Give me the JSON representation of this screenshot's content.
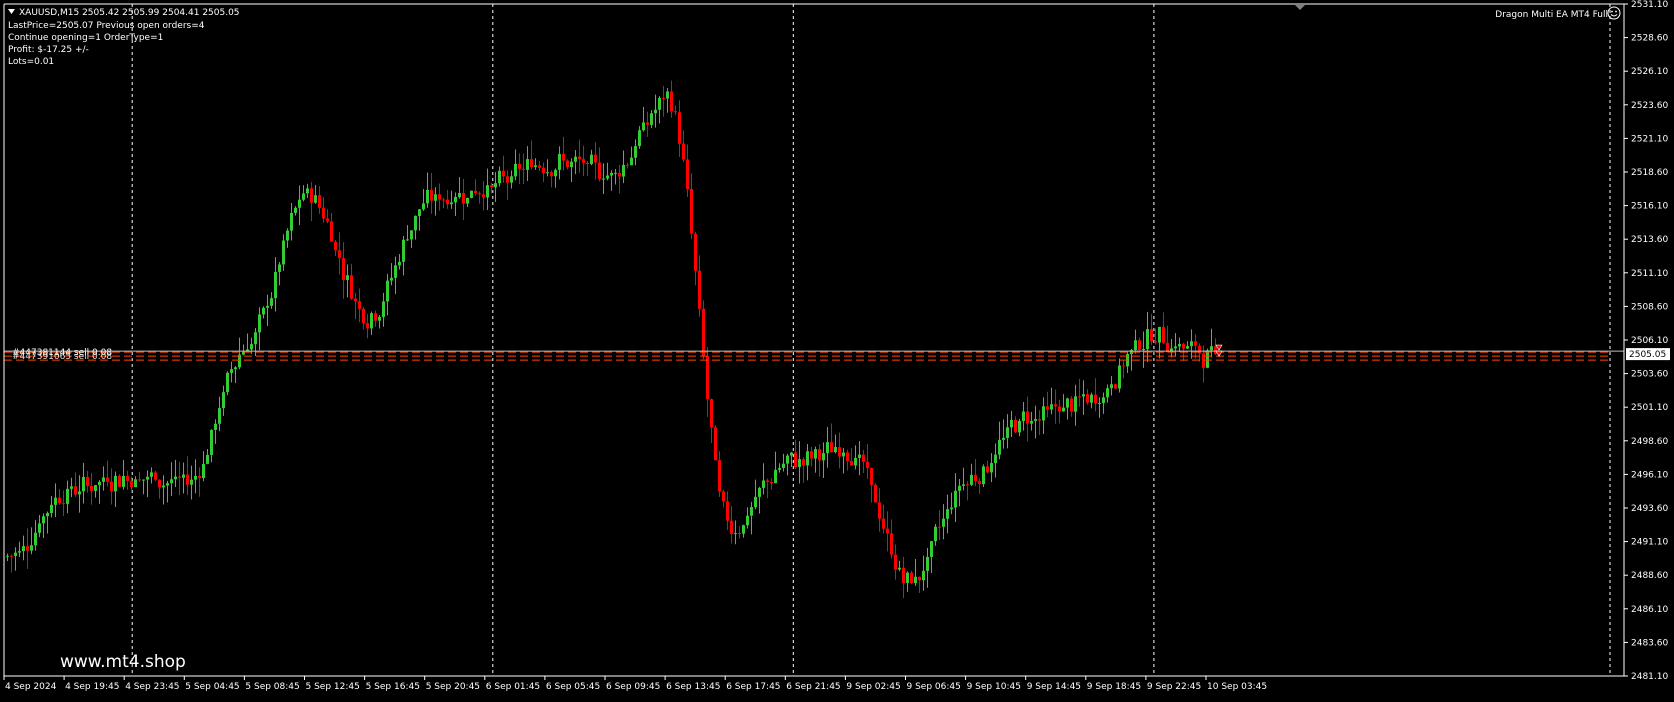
{
  "header": {
    "symbol_line": "XAUUSD,M15  2505.42 2505.99 2504.41 2505.05",
    "info_lines": [
      "LastPrice=2505.07 Previous open orders=4",
      "Continue opening=1 OrderType=1",
      "Profit: $-17.25 +/-",
      "Lots=0.01"
    ],
    "ea_name": "Dragon Multi EA MT4 Full",
    "watermark": "www.mt4.shop"
  },
  "order_labels": [
    "#447381144 sell 0.08",
    "#447391065 sell 0.08"
  ],
  "colors": {
    "background": "#000000",
    "bull_candle": "#32cd32",
    "bear_candle": "#ff0000",
    "grid": "#ffffff",
    "order_line": "#ff4500",
    "price_line": "#c0c0c0",
    "price_label_bg": "#ffffff",
    "price_label_text": "#000000"
  },
  "chart_data": {
    "type": "candlestick",
    "symbol": "XAUUSD",
    "timeframe": "M15",
    "current_price": 2505.05,
    "ylim": [
      2481.1,
      2531.1
    ],
    "y_ticks": [
      2531.1,
      2528.6,
      2526.1,
      2523.6,
      2521.1,
      2518.6,
      2516.1,
      2513.6,
      2511.1,
      2508.6,
      2506.1,
      2503.6,
      2501.1,
      2498.6,
      2496.1,
      2493.6,
      2491.1,
      2488.6,
      2486.1,
      2483.6,
      2481.1
    ],
    "x_ticks": [
      "4 Sep 2024",
      "4 Sep 19:45",
      "4 Sep 23:45",
      "5 Sep 04:45",
      "5 Sep 08:45",
      "5 Sep 12:45",
      "5 Sep 16:45",
      "5 Sep 20:45",
      "6 Sep 01:45",
      "6 Sep 05:45",
      "6 Sep 09:45",
      "6 Sep 13:45",
      "6 Sep 17:45",
      "6 Sep 21:45",
      "9 Sep 02:45",
      "9 Sep 06:45",
      "9 Sep 10:45",
      "9 Sep 14:45",
      "9 Sep 18:45",
      "9 Sep 22:45",
      "10 Sep 03:45"
    ],
    "day_separators": [
      "4 Sep 23:45",
      "6 Sep 01:45",
      "6 Sep 21:45",
      "9 Sep 22:45"
    ],
    "order_lines": [
      2505.2,
      2504.9,
      2504.6
    ],
    "price_path": [
      [
        "4 Sep 2024",
        2490.0
      ],
      [
        "4 Sep 19:45",
        2495.0
      ],
      [
        "4 Sep 23:45",
        2496.0
      ],
      [
        "5 Sep 04:45",
        2495.5
      ],
      [
        "5 Sep 08:45",
        2506.0
      ],
      [
        "5 Sep 12:45",
        2517.0
      ],
      [
        "5 Sep 16:45",
        2508.0
      ],
      [
        "5 Sep 20:45",
        2516.5
      ],
      [
        "6 Sep 01:45",
        2517.5
      ],
      [
        "6 Sep 05:45",
        2519.5
      ],
      [
        "6 Sep 09:45",
        2518.5
      ],
      [
        "6 Sep 13:45",
        2524.0
      ],
      [
        "6 Sep 17:45",
        2492.0
      ],
      [
        "6 Sep 21:45",
        2497.0
      ],
      [
        "9 Sep 02:45",
        2498.0
      ],
      [
        "9 Sep 06:45",
        2488.0
      ],
      [
        "9 Sep 10:45",
        2496.0
      ],
      [
        "9 Sep 14:45",
        2500.5
      ],
      [
        "9 Sep 18:45",
        2501.5
      ],
      [
        "9 Sep 22:45",
        2506.5
      ],
      [
        "10 Sep 03:45",
        2505.0
      ]
    ]
  }
}
